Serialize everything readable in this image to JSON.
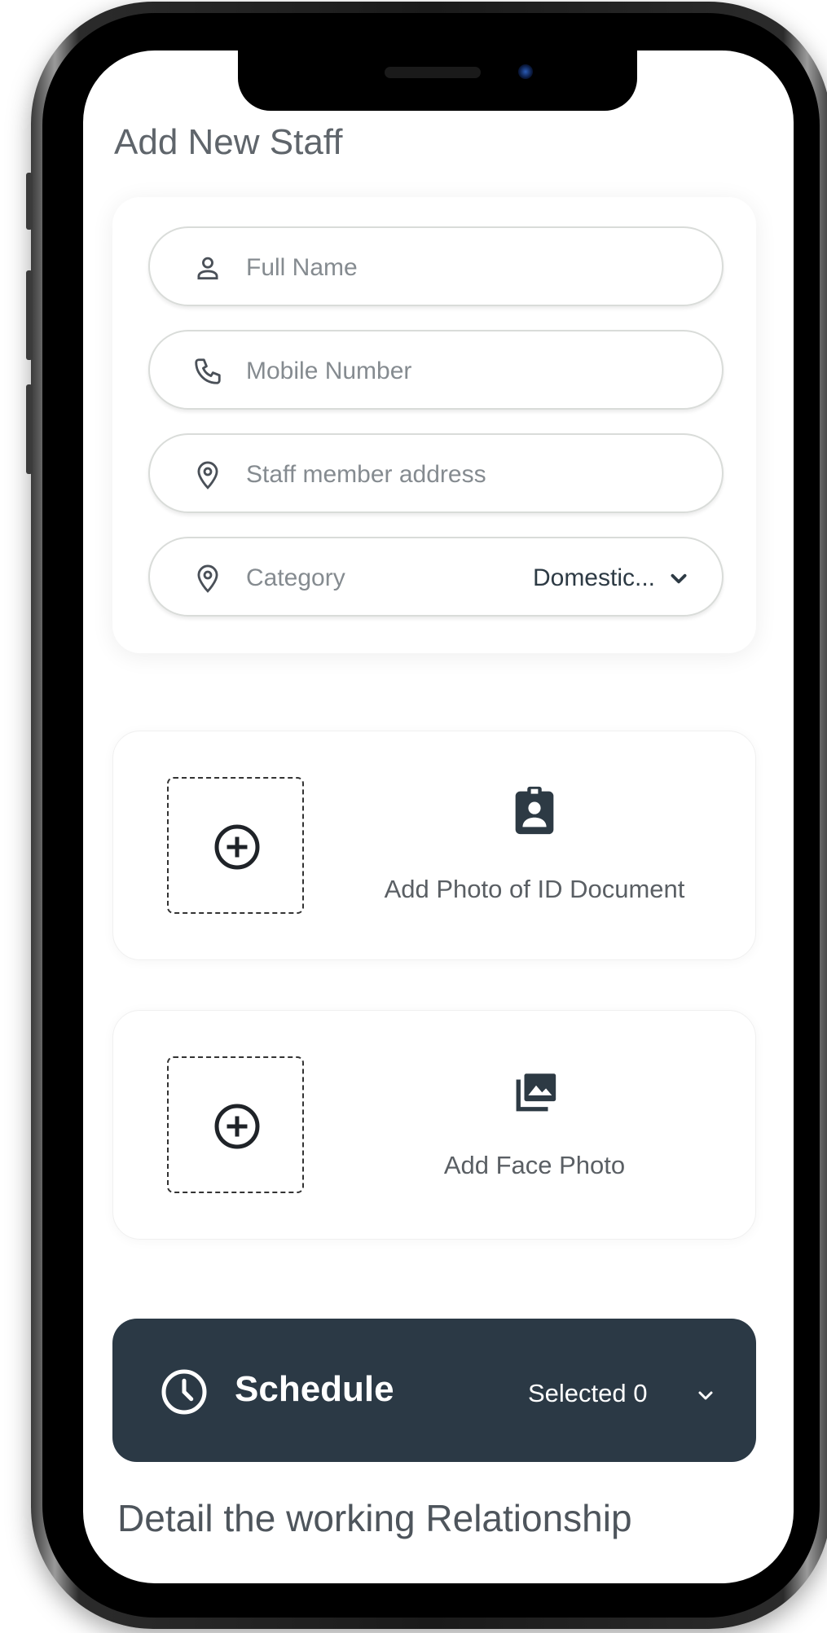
{
  "page": {
    "title": "Add New Staff"
  },
  "form": {
    "full_name_placeholder": "Full Name",
    "mobile_placeholder": "Mobile Number",
    "address_placeholder": "Staff member address",
    "category_label": "Category",
    "category_value": "Domestic..."
  },
  "uploads": {
    "id_document_label": "Add Photo of ID Document",
    "face_photo_label": "Add Face Photo"
  },
  "schedule": {
    "title": "Schedule",
    "selected_text": "Selected 0"
  },
  "section": {
    "title": "Detail the working Relationship"
  },
  "colors": {
    "schedule_bg": "#2b3945",
    "text_muted": "#858b90",
    "text_dark": "#2d3a44"
  },
  "icons": {
    "full_name": "user-icon",
    "mobile": "phone-icon",
    "address": "location-pin-icon",
    "category": "location-pin-icon",
    "id_document": "id-badge-icon",
    "face_photo": "photo-library-icon",
    "schedule": "clock-icon"
  }
}
